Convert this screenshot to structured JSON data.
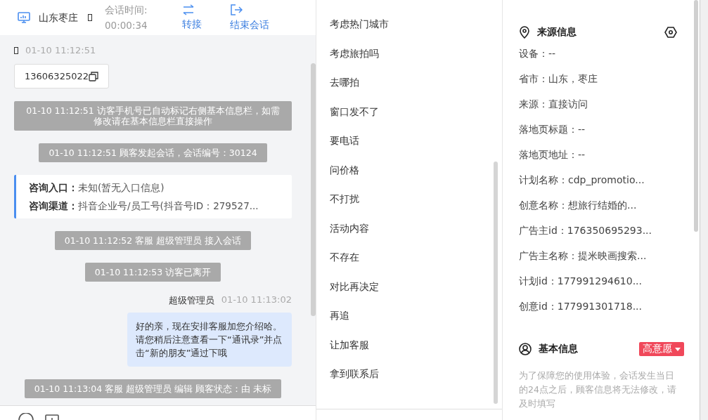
{
  "header": {
    "location": "山东枣庄",
    "session_label": "会话时间:",
    "session_time": "00:00:34",
    "actions": [
      {
        "kind": "transfer",
        "label": "转接"
      },
      {
        "kind": "end",
        "label": "结束会话"
      }
    ]
  },
  "chat": {
    "messages": [
      {
        "kind": "timestamp",
        "text": "01-10 11:12:51"
      },
      {
        "kind": "phone",
        "text": "13606325022"
      },
      {
        "kind": "system",
        "text": "01-10 11:12:51 访客手机号已自动标记右侧基本信息栏，如需修改请在基本信息栏直接操作"
      },
      {
        "kind": "system",
        "text": "01-10 11:12:51 顾客发起会话，会话编号：30124"
      },
      {
        "kind": "info_card",
        "rows": [
          {
            "label": "咨询入口：",
            "value": "未知(暂无入口信息)"
          },
          {
            "label": "咨询渠道：",
            "value": "抖音企业号/员工号(抖音号ID：279527..."
          }
        ]
      },
      {
        "kind": "system",
        "text": "01-10 11:12:52 客服 超级管理员 接入会话"
      },
      {
        "kind": "system",
        "text": "01-10 11:12:53 访客已离开"
      },
      {
        "kind": "agent",
        "sender": "超级管理员",
        "time": "01-10 11:13:02",
        "text": "好的亲，现在安排客服加您介绍哈。请您稍后注意查看一下“通讯录”并点击“新的朋友”通过下哦"
      },
      {
        "kind": "system",
        "text": "01-10 11:13:04 客服 超级管理员 编辑 顾客状态：由 未标"
      }
    ]
  },
  "quick_replies": [
    "考虑热门城市",
    "考虑旅拍吗",
    "去哪拍",
    "窗口发不了",
    "要电话",
    "问价格",
    "不打扰",
    "活动内容",
    "不存在",
    "对比再决定",
    "再追",
    "让加客服",
    "拿到联系后"
  ],
  "source_info": {
    "title": "来源信息",
    "rows": [
      "设备：--",
      "省市：山东，枣庄",
      "来源：直接访问",
      "落地页标题：--",
      "落地页地址：--",
      "计划名称：cdp_promotio...",
      "创意名称：想旅行结婚的...",
      "广告主id：176350695293...",
      "广告主名称：提米映画搜索...",
      "计划id：177991294610...",
      "创意id：177991301718..."
    ]
  },
  "basic_info": {
    "title": "基本信息",
    "tag": "高意愿",
    "note": "为了保障您的使用体验，会话发生当日的24点之后，顾客信息将无法修改，请及时填写"
  }
}
